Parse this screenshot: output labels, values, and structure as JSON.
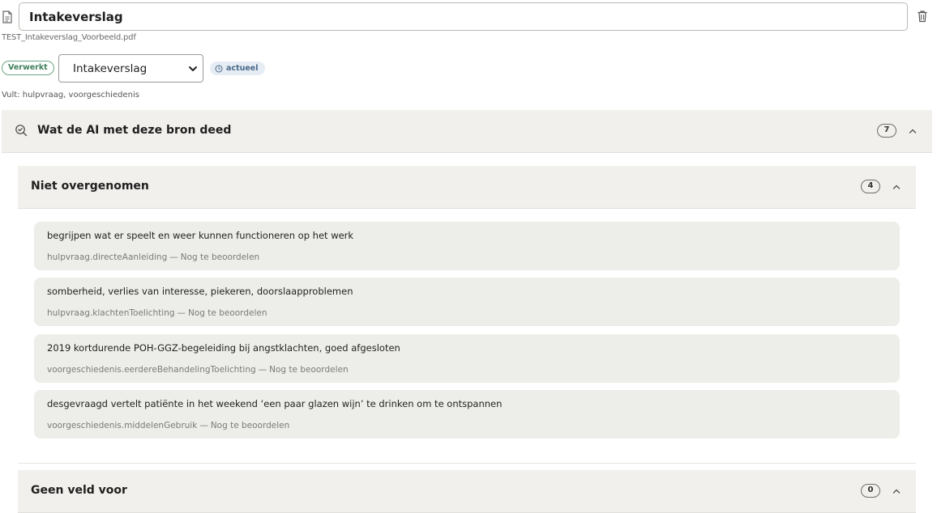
{
  "document": {
    "title_value": "Intakeverslag",
    "filename": "TEST_Intakeverslag_Voorbeeld.pdf",
    "status": "Verwerkt",
    "type_selected": "Intakeverslag",
    "version_badge": "actueel",
    "fills": "Vult: hulpvraag, voorgeschiedenis"
  },
  "ai_section": {
    "title": "Wat de AI met deze bron deed",
    "count": "7"
  },
  "not_taken": {
    "title": "Niet overgenomen",
    "count": "4",
    "items": [
      {
        "text": "begrijpen wat er speelt en weer kunnen functioneren op het werk",
        "field": "hulpvraag.directeAanleiding",
        "status": "Nog te beoordelen"
      },
      {
        "text": "somberheid, verlies van interesse, piekeren, doorslaapproblemen",
        "field": "hulpvraag.klachtenToelichting",
        "status": "Nog te beoordelen"
      },
      {
        "text": "2019 kortdurende POH-GGZ-begeleiding bij angstklachten, goed afgesloten",
        "field": "voorgeschiedenis.eerdereBehandelingToelichting",
        "status": "Nog te beoordelen"
      },
      {
        "text": "desgevraagd vertelt patiënte in het weekend ‘een paar glazen wijn’ te drinken om te ontspannen",
        "field": "voorgeschiedenis.middelenGebruik",
        "status": "Nog te beoordelen"
      }
    ]
  },
  "no_field": {
    "title": "Geen veld voor",
    "count": "0"
  },
  "meta_separator": "—"
}
